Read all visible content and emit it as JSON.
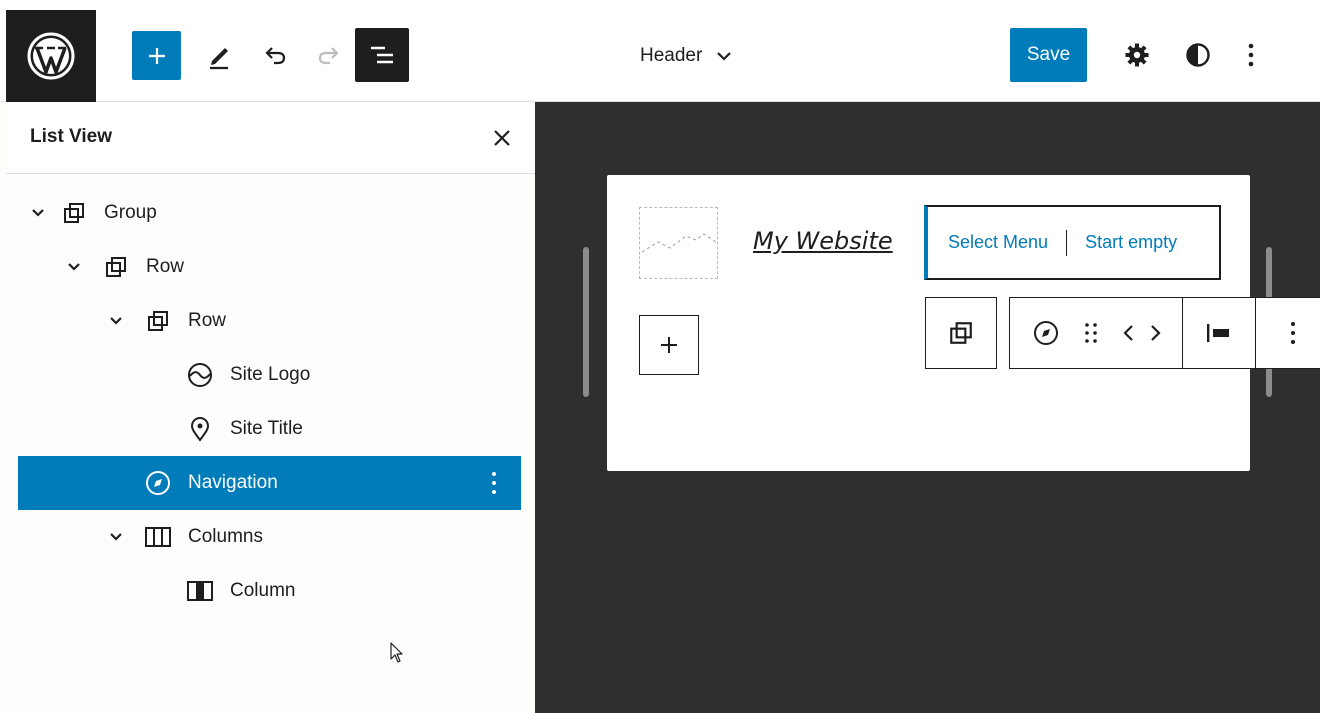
{
  "topbar": {
    "logo_icon": "wordpress-logo-icon",
    "document_title": "Header",
    "save_label": "Save",
    "accent_color": "#007cba"
  },
  "list_view": {
    "title": "List View",
    "items": [
      {
        "label": "Group",
        "icon": "group-icon",
        "expanded": true,
        "selected": false
      },
      {
        "label": "Row",
        "icon": "row-icon",
        "expanded": true,
        "selected": false
      },
      {
        "label": "Row",
        "icon": "row-icon",
        "expanded": true,
        "selected": false
      },
      {
        "label": "Site Logo",
        "icon": "site-logo-icon",
        "selected": false
      },
      {
        "label": "Site Title",
        "icon": "map-marker-icon",
        "selected": false
      },
      {
        "label": "Navigation",
        "icon": "compass-icon",
        "selected": true
      },
      {
        "label": "Columns",
        "icon": "columns-icon",
        "expanded": true,
        "selected": false
      },
      {
        "label": "Column",
        "icon": "column-icon",
        "selected": false
      }
    ]
  },
  "canvas": {
    "site_title": "My Website",
    "navigation": {
      "select_menu_label": "Select Menu",
      "start_empty_label": "Start empty"
    }
  }
}
